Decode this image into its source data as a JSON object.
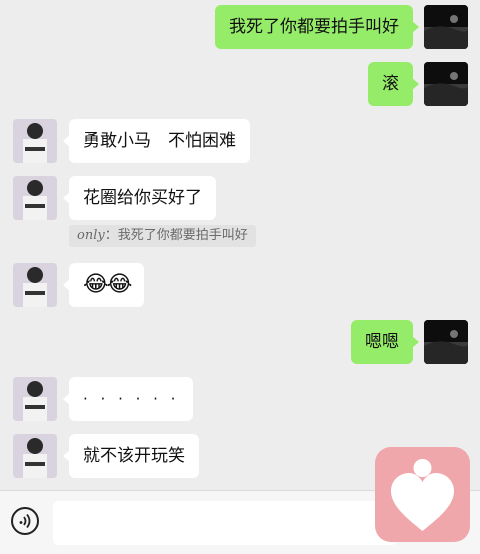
{
  "messages": [
    {
      "side": "me",
      "text": "我死了你都要拍手叫好"
    },
    {
      "side": "me",
      "text": "滚"
    },
    {
      "side": "other",
      "text": "勇敢小马　不怕困难"
    },
    {
      "side": "other",
      "text": "花圈给你买好了"
    },
    {
      "side": "other",
      "text": "😂😂"
    },
    {
      "side": "me",
      "text": "嗯嗯"
    },
    {
      "side": "other",
      "text": "· · · · · ·"
    },
    {
      "side": "other",
      "text": "就不该开玩笑"
    }
  ],
  "quote": {
    "signature": "only",
    "separator": "：",
    "text": "我死了你都要拍手叫好"
  },
  "colors": {
    "my_bubble": "#95ec69",
    "their_bubble": "#ffffff",
    "background": "#ededed",
    "heart_app": "#f0a7ab"
  },
  "icons": {
    "voice": "voice-input-icon",
    "heart": "heart-app-icon"
  }
}
